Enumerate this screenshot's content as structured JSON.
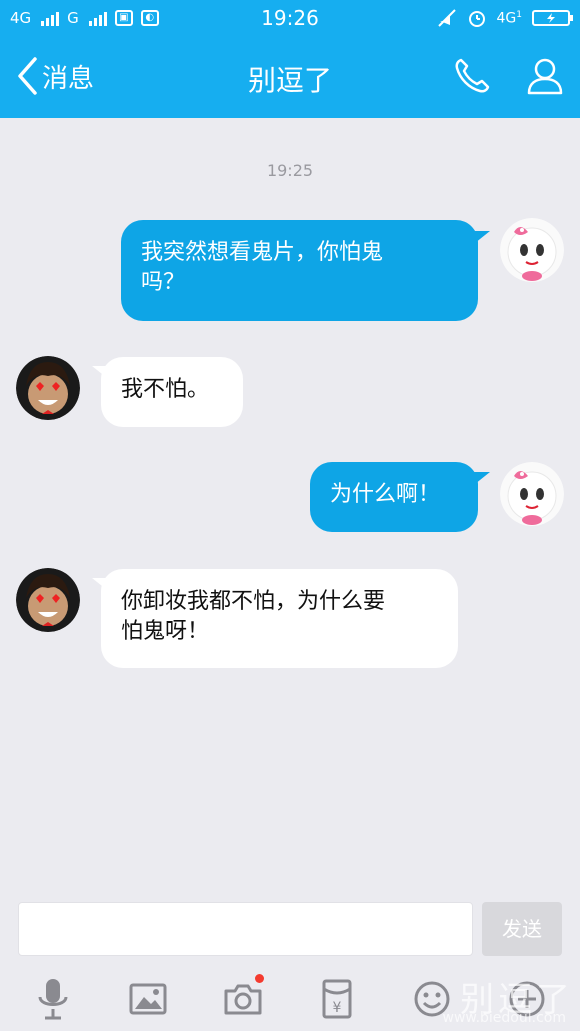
{
  "status_bar": {
    "network1": "4G",
    "network2": "G",
    "time": "19:26",
    "network_right": "4G",
    "sim_slot": "1"
  },
  "header": {
    "back_label": "消息",
    "title": "别逗了"
  },
  "chat": {
    "timestamp": "19:25",
    "messages": [
      {
        "direction": "out",
        "text_line1": "我突然想看鬼片，你怕鬼",
        "text_line2": "吗？"
      },
      {
        "direction": "in",
        "text_line1": "我不怕。"
      },
      {
        "direction": "out",
        "text_line1": "为什么啊！"
      },
      {
        "direction": "in",
        "text_line1": "你卸妆我都不怕，为什么要",
        "text_line2": "怕鬼呀！"
      }
    ]
  },
  "input": {
    "value": "",
    "send_label": "发送"
  },
  "toolbar": {
    "items": [
      "microphone-icon",
      "image-icon",
      "camera-icon",
      "red-packet-icon",
      "emoji-icon",
      "plus-icon"
    ],
    "camera_badge": true
  },
  "watermark": {
    "text": "别逗了",
    "url": "www.biedoul.com"
  },
  "colors": {
    "header": "#16aef0",
    "bubble_out": "#0ea5e6",
    "bubble_in": "#ffffff",
    "background": "#ebebf0"
  }
}
